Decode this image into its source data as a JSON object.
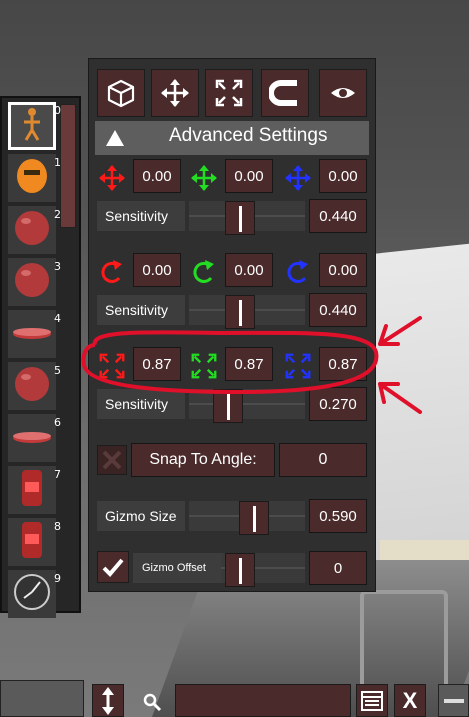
{
  "toolbar": {
    "buttons": [
      {
        "name": "cube-icon"
      },
      {
        "name": "move-arrows-icon"
      },
      {
        "name": "scale-arrows-icon"
      },
      {
        "name": "magnet-icon"
      },
      {
        "name": "eye-icon"
      }
    ]
  },
  "header": {
    "title": "Advanced Settings",
    "toggle_icon": "triangle-up-icon"
  },
  "position": {
    "x": "0.00",
    "y": "0.00",
    "z": "0.00",
    "sensitivity_label": "Sensitivity",
    "sensitivity_value": "0.440",
    "sensitivity_level": 0.44
  },
  "rotation": {
    "x": "0.00",
    "y": "0.00",
    "z": "0.00",
    "sensitivity_label": "Sensitivity",
    "sensitivity_value": "0.440",
    "sensitivity_level": 0.44
  },
  "scale": {
    "x": "0.87",
    "y": "0.87",
    "z": "0.87",
    "sensitivity_label": "Sensitivity",
    "sensitivity_value": "0.270",
    "sensitivity_level": 0.27
  },
  "snap": {
    "label": "Snap To Angle:",
    "value": "0",
    "enabled": false
  },
  "gizmo_size": {
    "label": "Gizmo Size",
    "value": "0.590",
    "level": 0.59
  },
  "gizmo_offset": {
    "label": "Gizmo Offset",
    "value": "0",
    "enabled": true,
    "level": 0.0
  },
  "thumbnails": [
    {
      "index": "0",
      "kind": "figure"
    },
    {
      "index": "1",
      "kind": "head"
    },
    {
      "index": "2",
      "kind": "sphere"
    },
    {
      "index": "3",
      "kind": "sphere"
    },
    {
      "index": "4",
      "kind": "disc"
    },
    {
      "index": "5",
      "kind": "sphere"
    },
    {
      "index": "6",
      "kind": "disc"
    },
    {
      "index": "7",
      "kind": "cylinder"
    },
    {
      "index": "8",
      "kind": "cylinder"
    },
    {
      "index": "9",
      "kind": "clock"
    }
  ],
  "bottom_bar": {
    "close_label": "X"
  },
  "colors": {
    "x_axis": "#ff1a1a",
    "y_axis": "#22dd22",
    "z_axis": "#2233ff",
    "field_bg": "#4a2a2a",
    "panel_bg": "#2f2f2f",
    "annotation": "#e0102a"
  }
}
